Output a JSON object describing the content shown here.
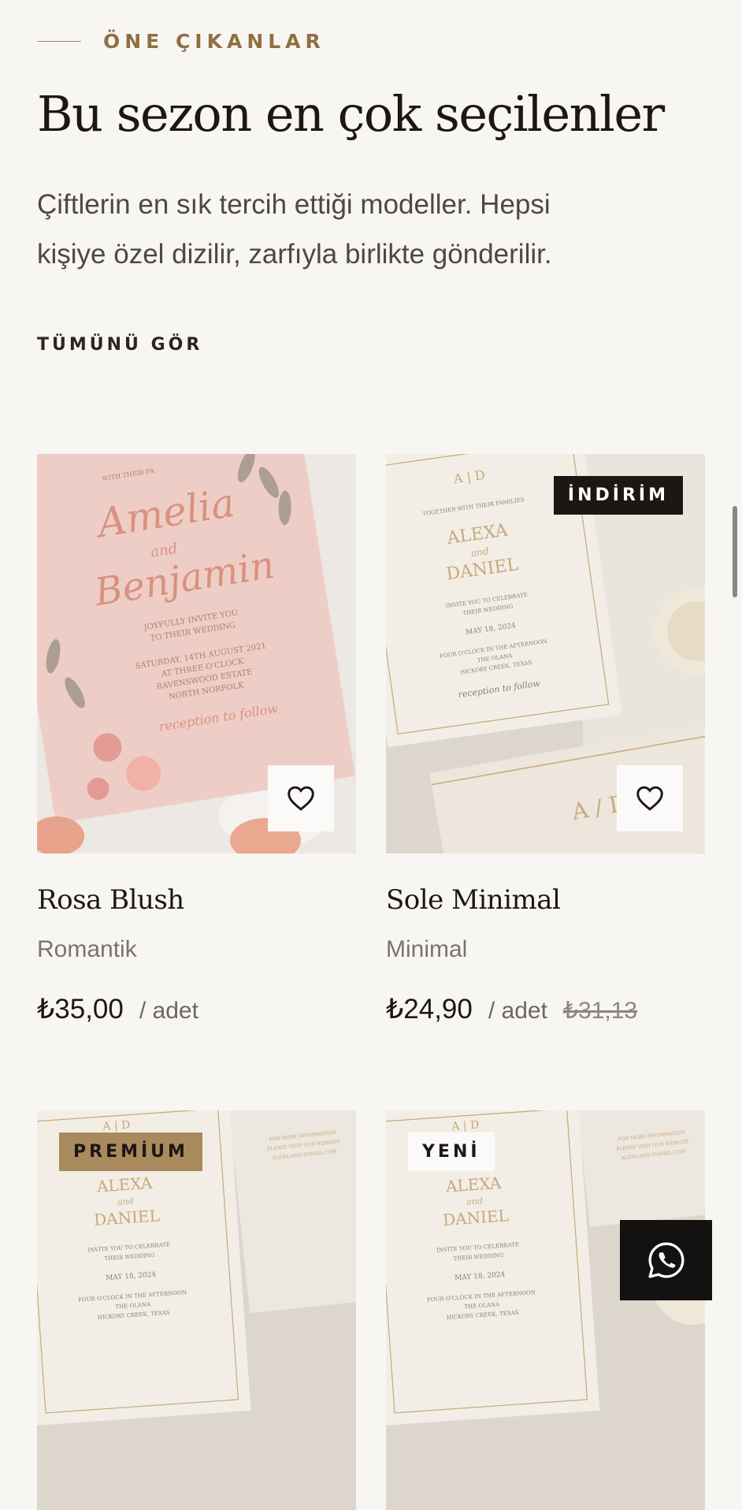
{
  "section": {
    "eyebrow": "ÖNE ÇIKANLAR",
    "title": "Bu sezon en çok seçilenler",
    "subtitle": "Çiftlerin en sık tercih ettiği modeller. Hepsi kişiye özel dizilir, zarfıyla birlikte gönderilir.",
    "see_all": "TÜMÜNÜ GÖR"
  },
  "products": [
    {
      "name": "Rosa Blush",
      "category": "Romantik",
      "price": "₺35,00",
      "unit": "/ adet",
      "card": {
        "l1": "WITH THEIR FA",
        "n1": "Amelia",
        "and": "and",
        "n2": "Benjamin",
        "t1": "JOYFULLY INVITE YOU",
        "t2": "TO THEIR WEDDING",
        "t3": "SATURDAY, 14TH AUGUST 2021",
        "t4": "AT THREE O'CLOCK",
        "t5": "RAVENSWOOD ESTATE",
        "t6": "NORTH NORFOLK",
        "t7": "reception to follow"
      }
    },
    {
      "name": "Sole Minimal",
      "category": "Minimal",
      "price": "₺24,90",
      "unit": "/ adet",
      "old_price": "₺31,13",
      "badge": "İNDİRİM",
      "card": {
        "mono": "A | D",
        "t0": "TOGETHER WITH THEIR FAMILIES",
        "n1": "ALEXA",
        "and": "and",
        "n2": "DANIEL",
        "t1": "INVITE YOU TO CELEBRATE",
        "t2": "THEIR WEDDING",
        "t3": "MAY 18, 2024",
        "t4": "FOUR O'CLOCK IN THE AFTERNOON",
        "t5": "THE OLANA",
        "t6": "HICKORY CREEK, TEXAS",
        "t7": "reception to follow",
        "env": "A / D"
      }
    },
    {
      "badge": "PREMİUM",
      "card": {
        "mono": "A | D",
        "n1": "ALEXA",
        "and": "and",
        "n2": "DANIEL",
        "t1": "INVITE YOU TO CELEBRATE",
        "t2": "THEIR WEDDING",
        "t3": "MAY 18, 2024",
        "t4": "FOUR O'CLOCK IN THE AFTERNOON",
        "t5": "THE OLANA",
        "t6": "HICKORY CREEK, TEXAS",
        "side1": "FOR MORE INFORMATION",
        "side2": "PLEASE VISIT OUR WEBSITE",
        "side3": "ALEXA-AND-DANIEL.COM"
      }
    },
    {
      "badge": "YENİ",
      "card": {
        "mono": "A | D",
        "n1": "ALEXA",
        "and": "and",
        "n2": "DANIEL",
        "t1": "INVITE YOU TO CELEBRATE",
        "t2": "THEIR WEDDING",
        "t3": "MAY 18, 2024",
        "t4": "FOUR O'CLOCK IN THE AFTERNOON",
        "t5": "THE OLANA",
        "t6": "HICKORY CREEK, TEXAS",
        "side1": "FOR MORE INFORMATION",
        "side2": "PLEASE VISIT OUR WEBSITE",
        "side3": "ALEXA-AND-DANIEL.COM"
      }
    }
  ],
  "icons": {
    "favorite": "heart-icon",
    "whatsapp": "whatsapp-icon"
  },
  "colors": {
    "background": "#f8f6f3",
    "accent_gold": "#a98a5c",
    "dark": "#1c1714",
    "blush": "#efcdc7"
  }
}
